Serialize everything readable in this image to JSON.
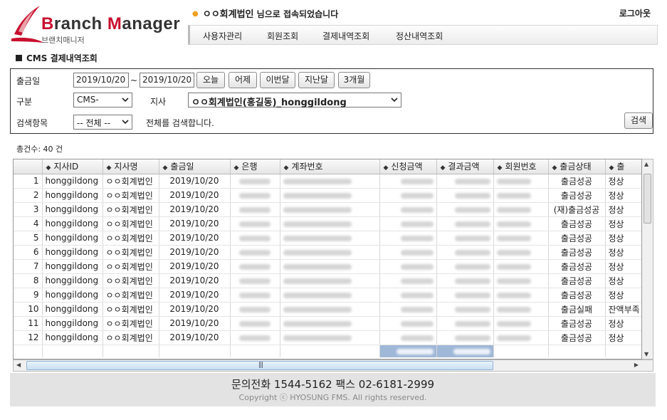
{
  "header": {
    "logo_word1_b": "B",
    "logo_word1_rest": "ranch ",
    "logo_word2_m": "M",
    "logo_word2_rest": "anager",
    "logo_sub": "브랜치매니저",
    "welcome_name": "ㅇㅇ회계법인",
    "welcome_suffix": " 님으로 접속되었습니다",
    "logout": "로그아웃",
    "menu": [
      "사용자관리",
      "회원조회",
      "결제내역조회",
      "정산내역조회"
    ]
  },
  "page_title": "CMS 결제내역조회",
  "search": {
    "date_label": "출금일",
    "date_from": "2019/10/20",
    "date_sep": "~",
    "date_to": "2019/10/20",
    "quick_buttons": [
      "오늘",
      "어제",
      "이번달",
      "지난달",
      "3개월"
    ],
    "type_label": "구분",
    "type_value": "CMS-",
    "branch_label": "지사",
    "branch_value": "ㅇㅇ회계법인(홍길동)_honggildong",
    "field_label": "검색항목",
    "field_value": "-- 전체 --",
    "field_hint": "전체를 검색합니다.",
    "search_button": "검색"
  },
  "total_count": "총건수: 40 건",
  "table": {
    "columns": [
      "지사ID",
      "지사명",
      "출금일",
      "은행",
      "계좌번호",
      "신청금액",
      "결과금액",
      "회원번호",
      "출금상태",
      "출"
    ],
    "rows": [
      {
        "no": "1",
        "id": "honggildong",
        "name": "ㅇㅇ회계법인",
        "date": "2019/10/20",
        "status": "출금성공",
        "note": "정상"
      },
      {
        "no": "2",
        "id": "honggildong",
        "name": "ㅇㅇ회계법인",
        "date": "2019/10/20",
        "status": "출금성공",
        "note": "정상"
      },
      {
        "no": "3",
        "id": "honggildong",
        "name": "ㅇㅇ회계법인",
        "date": "2019/10/20",
        "status": "(재)출금성공",
        "note": "정상"
      },
      {
        "no": "4",
        "id": "honggildong",
        "name": "ㅇㅇ회계법인",
        "date": "2019/10/20",
        "status": "출금성공",
        "note": "정상"
      },
      {
        "no": "5",
        "id": "honggildong",
        "name": "ㅇㅇ회계법인",
        "date": "2019/10/20",
        "status": "출금성공",
        "note": "정상"
      },
      {
        "no": "6",
        "id": "honggildong",
        "name": "ㅇㅇ회계법인",
        "date": "2019/10/20",
        "status": "출금성공",
        "note": "정상"
      },
      {
        "no": "7",
        "id": "honggildong",
        "name": "ㅇㅇ회계법인",
        "date": "2019/10/20",
        "status": "출금성공",
        "note": "정상"
      },
      {
        "no": "8",
        "id": "honggildong",
        "name": "ㅇㅇ회계법인",
        "date": "2019/10/20",
        "status": "출금성공",
        "note": "정상"
      },
      {
        "no": "9",
        "id": "honggildong",
        "name": "ㅇㅇ회계법인",
        "date": "2019/10/20",
        "status": "출금성공",
        "note": "정상"
      },
      {
        "no": "10",
        "id": "honggildong",
        "name": "ㅇㅇ회계법인",
        "date": "2019/10/20",
        "status": "출금실패",
        "note": "잔액부족"
      },
      {
        "no": "11",
        "id": "honggildong",
        "name": "ㅇㅇ회계법인",
        "date": "2019/10/20",
        "status": "출금성공",
        "note": "정상"
      },
      {
        "no": "12",
        "id": "honggildong",
        "name": "ㅇㅇ회계법인",
        "date": "2019/10/20",
        "status": "출금성공",
        "note": "정상"
      }
    ]
  },
  "footer": {
    "phone": "문의전화 1544-5162   팩스 02-6181-2999",
    "copyright": "Copyright ⓒ HYOSUNG FMS. All rights reserved."
  },
  "colors": {
    "brand_red": "#c8102e",
    "welcome_dot": "#f0a020",
    "sum_highlight": "#9fb8d8",
    "footer_bg": "#e3e3e3"
  },
  "icons": [
    "sort-arrows-icon",
    "dropdown-arrow-icon",
    "scroll-up-icon",
    "scroll-down-icon",
    "scroll-left-icon",
    "scroll-right-icon"
  ]
}
